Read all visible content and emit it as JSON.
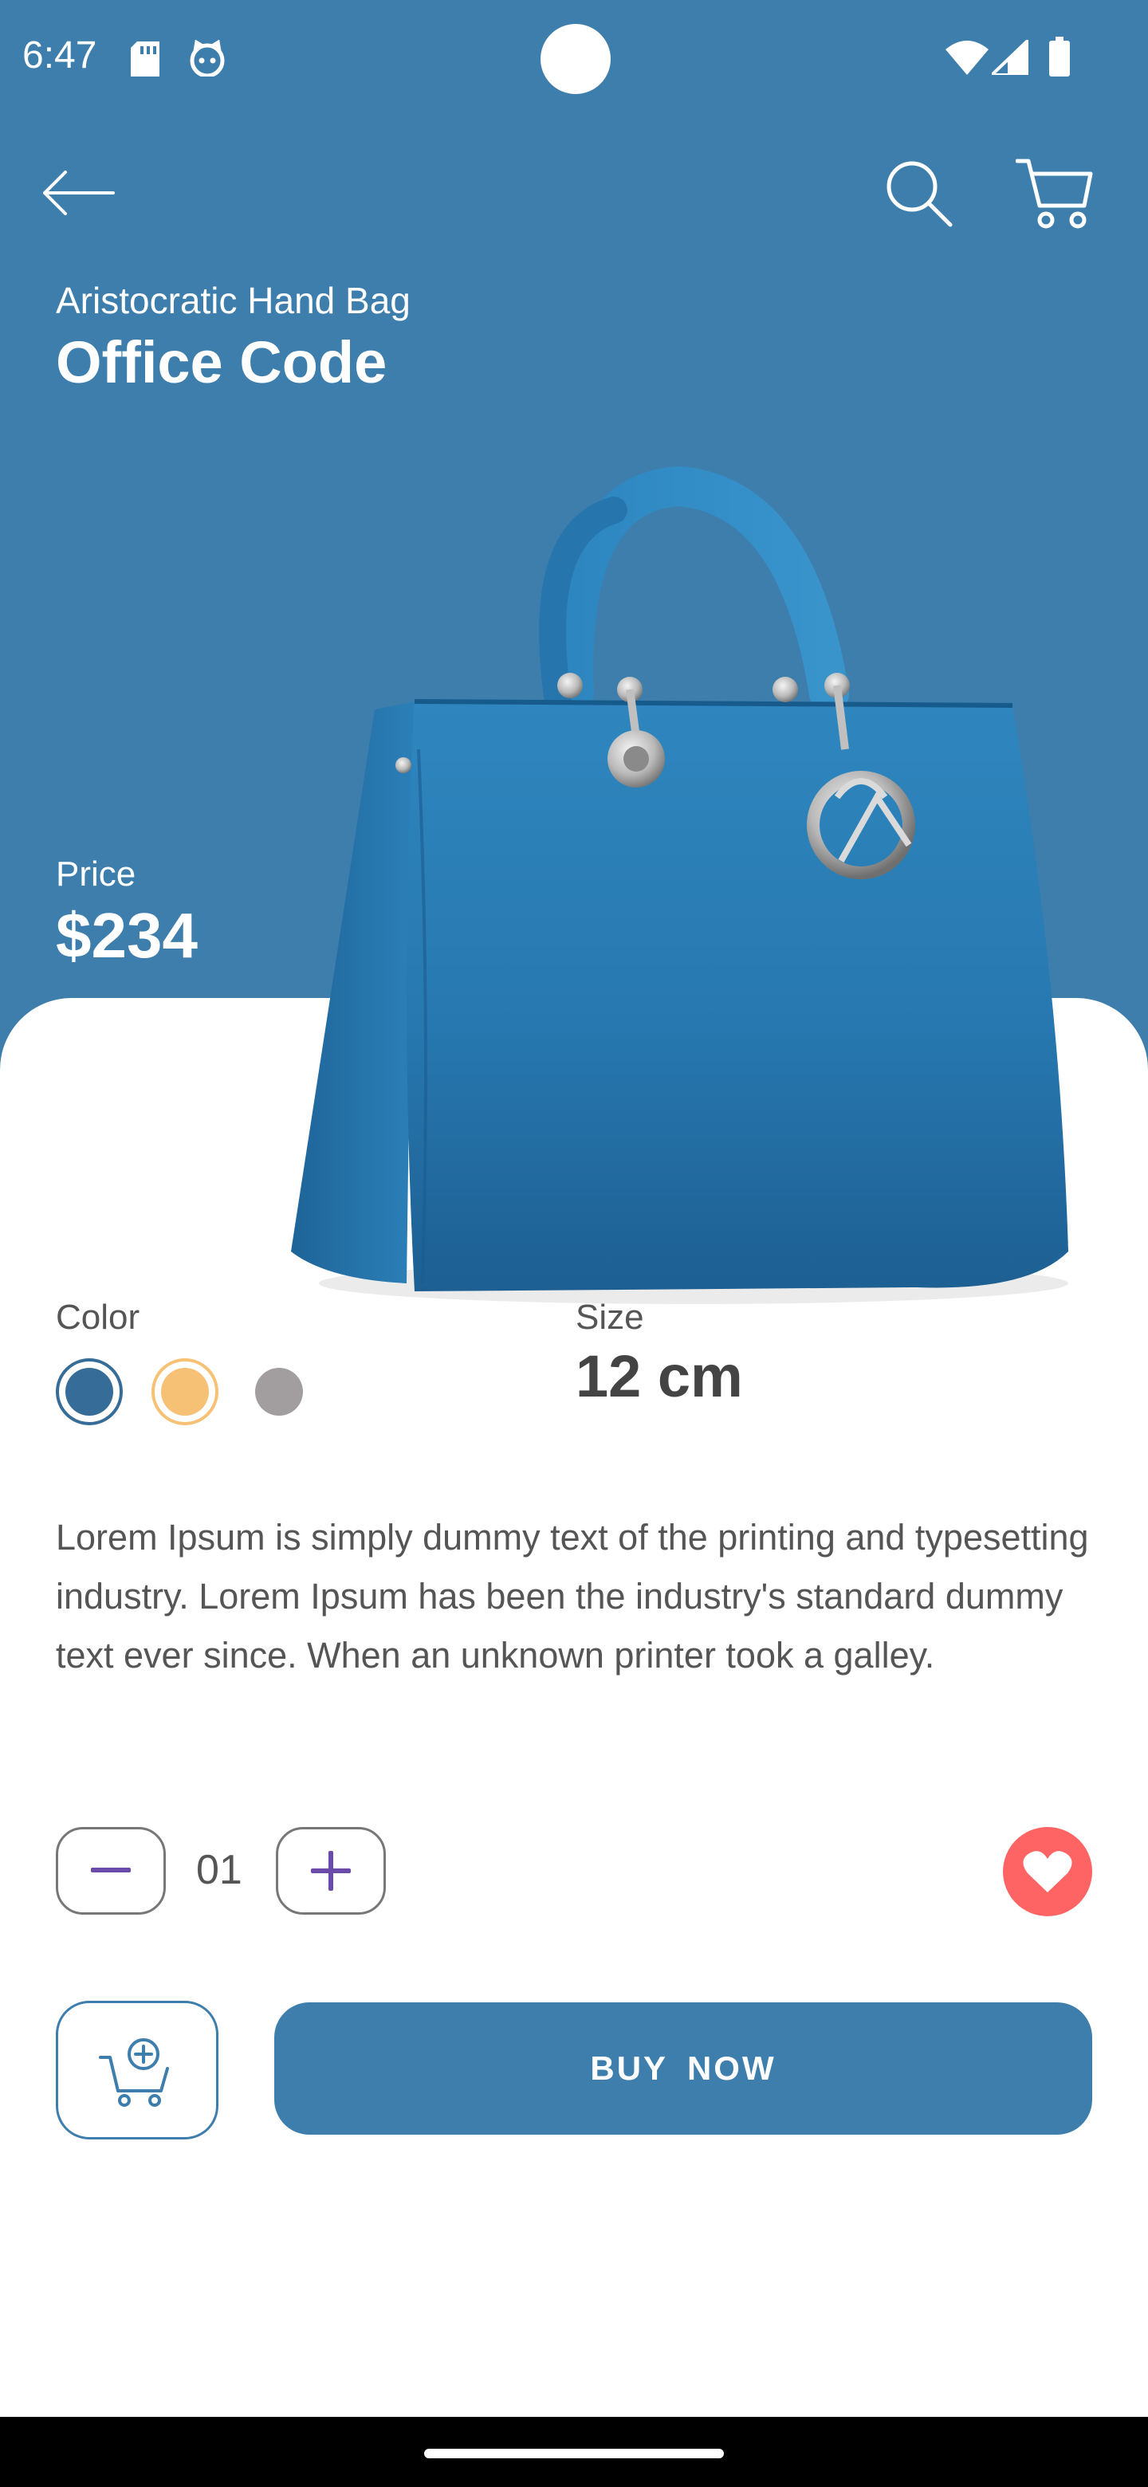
{
  "status_bar": {
    "time": "6:47",
    "icons": [
      "sd-card-icon",
      "cat-face-icon",
      "wifi-icon",
      "signal-icon",
      "battery-icon"
    ]
  },
  "app_bar": {
    "icons": [
      "back-arrow-icon",
      "search-icon",
      "cart-icon"
    ]
  },
  "product": {
    "subtitle": "Aristocratic Hand Bag",
    "title": "Office Code",
    "price_label": "Price",
    "price": "$234",
    "color_label": "Color",
    "colors": [
      "#356C98",
      "#F6C175",
      "#A29D9E"
    ],
    "selected_color": "#356C98",
    "size_label": "Size",
    "size": "12 cm",
    "description": "Lorem Ipsum is simply dummy text of the printing and typesetting industry. Lorem Ipsum has been the industry's standard dummy text ever since. When an unknown printer took a galley."
  },
  "quantity": {
    "value": "01"
  },
  "actions": {
    "buy_label": "BUY  NOW"
  },
  "theme": {
    "primary": "#3D7EAC",
    "favorite": "#FF6464",
    "stepper_icon": "#6A4BAA"
  }
}
